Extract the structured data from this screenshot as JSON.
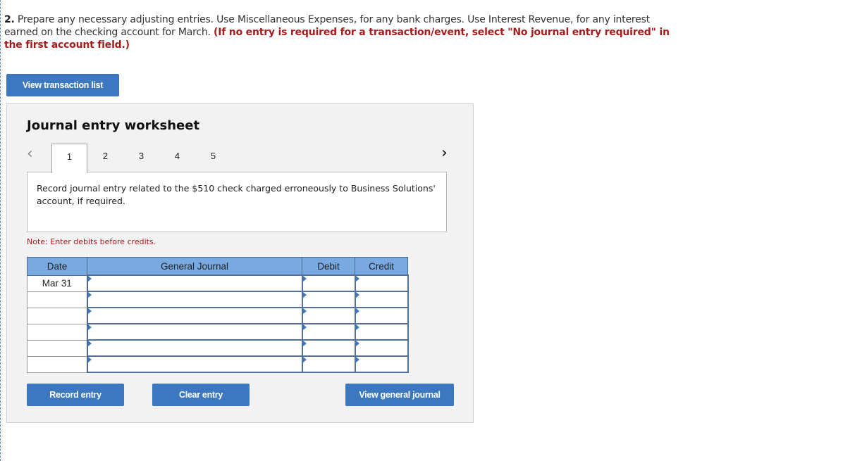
{
  "question": {
    "number": "2.",
    "text": " Prepare any necessary adjusting entries. Use Miscellaneous Expenses, for any bank charges. Use Interest Revenue, for any interest earned on the checking account for March. ",
    "instruction": "(If no entry is required for a transaction/event, select \"No journal entry required\" in the first account field.)"
  },
  "buttons": {
    "view_transaction_list": "View transaction list",
    "record_entry": "Record entry",
    "clear_entry": "Clear entry",
    "view_general_journal": "View general journal"
  },
  "worksheet": {
    "title": "Journal entry worksheet",
    "nav_prev_icon": "chevron-left-icon",
    "nav_next_icon": "chevron-right-icon",
    "tabs": [
      {
        "label": "1",
        "active": true
      },
      {
        "label": "2",
        "active": false
      },
      {
        "label": "3",
        "active": false
      },
      {
        "label": "4",
        "active": false
      },
      {
        "label": "5",
        "active": false
      }
    ],
    "description": "Record journal entry related to the $510 check charged erroneously to Business Solutions' account, if required.",
    "note": "Note: Enter debits before credits.",
    "table": {
      "headers": [
        "Date",
        "General Journal",
        "Debit",
        "Credit"
      ],
      "rows": [
        {
          "date": "Mar 31",
          "account": "",
          "debit": "",
          "credit": ""
        },
        {
          "date": "",
          "account": "",
          "debit": "",
          "credit": ""
        },
        {
          "date": "",
          "account": "",
          "debit": "",
          "credit": ""
        },
        {
          "date": "",
          "account": "",
          "debit": "",
          "credit": ""
        },
        {
          "date": "",
          "account": "",
          "debit": "",
          "credit": ""
        },
        {
          "date": "",
          "account": "",
          "debit": "",
          "credit": ""
        }
      ]
    }
  },
  "colors": {
    "button_bg": "#3b78bf",
    "header_bg": "#78a9e0",
    "warning_text": "#a51c1c",
    "panel_bg": "#f2f2f2"
  }
}
